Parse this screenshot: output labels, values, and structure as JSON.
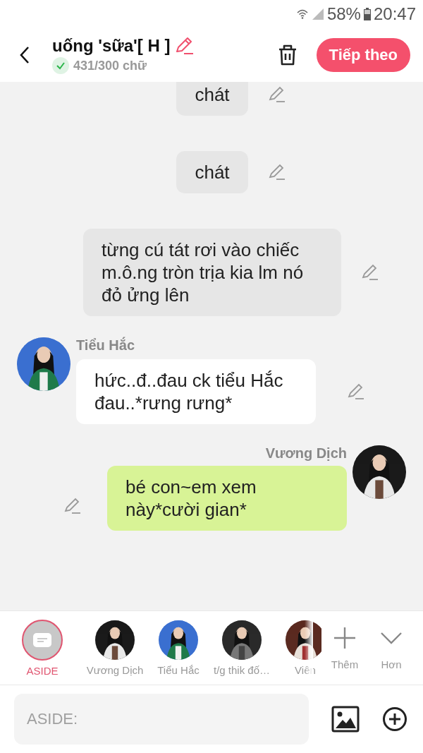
{
  "status_bar": {
    "battery": "58%",
    "time": "20:47"
  },
  "header": {
    "title": "uống 'sữa'[ H ]",
    "word_count": "431/300 chữ",
    "count_ok": true,
    "next_button": "Tiếp theo"
  },
  "messages": [
    {
      "kind": "aside",
      "text": "chát"
    },
    {
      "kind": "aside",
      "text": "chát"
    },
    {
      "kind": "aside",
      "text": "từng cú tát rơi vào chiếc m.ô.ng tròn trịa kia lm nó đỏ ửng lên"
    },
    {
      "kind": "left",
      "name": "Tiểu Hắc",
      "text": "hức..đ..đau ck tiểu Hắc đau..*rưng rưng*"
    },
    {
      "kind": "right",
      "name": "Vương Dịch",
      "text": "bé con~em xem này*cười gian*"
    }
  ],
  "characters": [
    {
      "kind": "aside",
      "name": "ASIDE",
      "selected": true
    },
    {
      "kind": "avatar",
      "name": "Vương Dịch",
      "selected": false
    },
    {
      "kind": "avatar",
      "name": "Tiểu Hắc",
      "selected": false
    },
    {
      "kind": "avatar",
      "name": "t/g thik đố…",
      "selected": false
    },
    {
      "kind": "avatar",
      "name": "Viên",
      "selected": false
    }
  ],
  "more_button": "Thêm",
  "expand_button": "Hơn",
  "input": {
    "placeholder": "ASIDE:"
  }
}
